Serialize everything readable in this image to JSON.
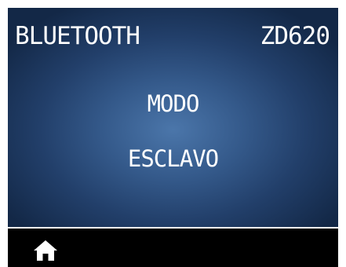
{
  "header": {
    "title": "BLUETOOTH",
    "model": "ZD620"
  },
  "main": {
    "line_1": "MODO",
    "line_2": "ESCLAVO"
  },
  "footer": {
    "home_icon": "home-icon"
  },
  "colors": {
    "screen_center": "#4b76aa",
    "screen_edge": "#132847",
    "text": "#ffffff",
    "footer_background": "#000000",
    "divider": "#ffffff"
  }
}
